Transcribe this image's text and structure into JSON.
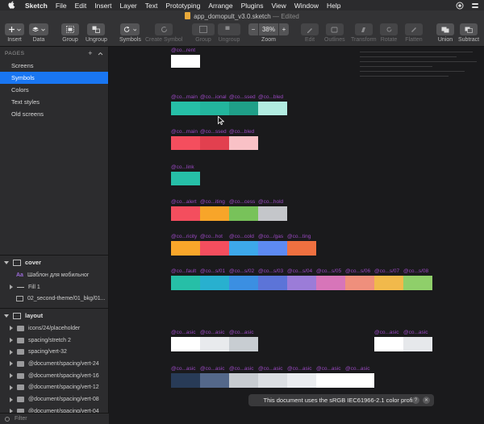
{
  "menubar": {
    "items": [
      "Sketch",
      "File",
      "Edit",
      "Insert",
      "Layer",
      "Text",
      "Prototyping",
      "Arrange",
      "Plugins",
      "View",
      "Window",
      "Help"
    ]
  },
  "window": {
    "title": "app_domopult_v3.0.sketch",
    "edited": "— Edited"
  },
  "toolbar": {
    "insert": "Insert",
    "data": "Data",
    "group": "Group",
    "ungroup": "Ungroup",
    "symbols": "Symbols",
    "create_symbol": "Create Symbol",
    "group2": "Group",
    "ungroup2": "Ungroup",
    "zoom_label": "Zoom",
    "zoom_minus": "−",
    "zoom_value": "38%",
    "zoom_plus": "+",
    "edit": "Edit",
    "outlines": "Outlines",
    "transform": "Transform",
    "rotate": "Rotate",
    "flatten": "Flatten",
    "union": "Union",
    "subtract": "Subtract"
  },
  "sidebar": {
    "pages_header": "PAGES",
    "pages": [
      "Screens",
      "Symbols",
      "Colors",
      "Text styles",
      "Old screens"
    ],
    "selected_page": "Symbols",
    "group_cover": "cover",
    "cover_items": [
      "Шаблон для мобильног",
      "Fill 1",
      "02_second-theme/01_bkg/01..."
    ],
    "group_layout": "layout",
    "layout_items": [
      "icons/24/placeholder",
      "spacing/stretch 2",
      "spacing/vert-32",
      "@document/spacing/vert-24",
      "@document/spacing/vert-16",
      "@document/spacing/vert-12",
      "@document/spacing/vert-08",
      "@document/spacing/vert-04"
    ],
    "filter": "Filter"
  },
  "canvas": {
    "rows": [
      {
        "labels": [
          "@co...rent"
        ],
        "colors": [
          "#ffffff"
        ]
      },
      {
        "labels": [
          "@co...main",
          "@co...ional",
          "@co...ssed",
          "@co...bled"
        ],
        "colors": [
          "#26bfa7",
          "#23b59d",
          "#1f9f88",
          "#b2ece1"
        ]
      },
      {
        "labels": [
          "@co...main",
          "@co...ssed",
          "@co...bled"
        ],
        "colors": [
          "#f44e5e",
          "#e2404f",
          "#f9c1c6"
        ]
      },
      {
        "labels": [
          "@co...link"
        ],
        "colors": [
          "#26bfa7"
        ]
      },
      {
        "labels": [
          "@co...alert",
          "@co...iting",
          "@co...cess",
          "@co...hold"
        ],
        "colors": [
          "#f44e5e",
          "#f8a529",
          "#78c25a",
          "#c4c6ca"
        ]
      },
      {
        "labels": [
          "@co...ricity",
          "@co...hot",
          "@co...cold",
          "@co.../gas",
          "@co...ting"
        ],
        "colors": [
          "#f9a62a",
          "#f44e5e",
          "#3da8ea",
          "#5d8af2",
          "#ef7040"
        ]
      },
      {
        "labels": [
          "@co...fault",
          "@co...s/01",
          "@co...s/02",
          "@co...s/03",
          "@co...s/04",
          "@co...s/05",
          "@co...s/06",
          "@co...s/07",
          "@co...s/08"
        ],
        "colors": [
          "#26bfa7",
          "#28b0cf",
          "#3b8fe2",
          "#5c74d8",
          "#9b7cd8",
          "#d775b9",
          "#ef8f7c",
          "#f1b94b",
          "#8fcf6a"
        ]
      },
      {
        "labels": [
          "@co...asic",
          "@co...asic",
          "@co...asic"
        ],
        "colors": [
          "#ffffff",
          "#e8eaed",
          "#c8cdd2"
        ]
      },
      {
        "labels": [
          "@co...asic",
          "@co...asic"
        ],
        "colors": [
          "#ffffff",
          "#e6e8eb"
        ]
      },
      {
        "labels": [
          "@co...asic",
          "@co...asic",
          "@co...asic",
          "@co...asic",
          "@co...asic",
          "@co...asic",
          "@co...asic"
        ],
        "colors": [
          "#283b57",
          "#54688a",
          "#c8ccd1",
          "#dcdfe3",
          "#ebedf0",
          "#ffffff",
          "#ffffff"
        ]
      }
    ],
    "toast": "This document uses the sRGB IEC61966-2.1 color profile.",
    "toast_help": "?",
    "toast_close": "✕"
  }
}
